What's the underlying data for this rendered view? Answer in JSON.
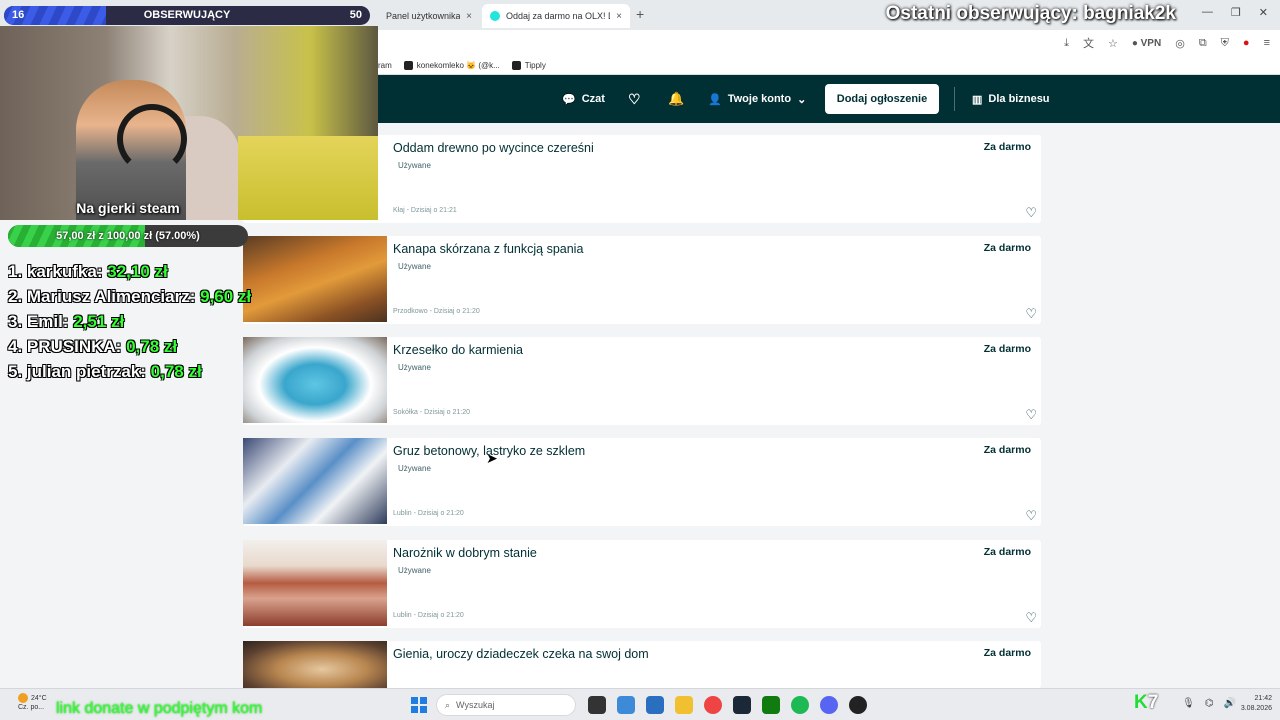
{
  "browser": {
    "tabs": [
      {
        "label": "Panel użytkownika",
        "close": "×"
      },
      {
        "label": "Oddaj za darmo na OLX! Dodaj",
        "close": "×"
      }
    ],
    "new_tab": "+",
    "window_controls": [
      "—",
      "❐",
      "✕"
    ],
    "vpn_label": "VPN",
    "bookmarks": [
      "ram",
      "konekomleko 🐱 (@k...",
      "Tipply"
    ]
  },
  "olx_header": {
    "chat_label": "Czat",
    "account_label": "Twoje konto",
    "add_listing_label": "Dodaj ogłoszenie",
    "business_label": "Dla biznesu"
  },
  "listings": [
    {
      "title": "Oddam drewno po wycince czereśni",
      "condition": "Używane",
      "location": "Kłaj - Dzisiaj o 21:21",
      "price": "Za darmo"
    },
    {
      "title": "Kanapa skórzana z funkcją spania",
      "condition": "Używane",
      "location": "Przodkowo - Dzisiaj o 21:20",
      "price": "Za darmo"
    },
    {
      "title": "Krzesełko do karmienia",
      "condition": "Używane",
      "location": "Sokółka - Dzisiaj o 21:20",
      "price": "Za darmo"
    },
    {
      "title": "Gruz betonowy, lastryko ze szklem",
      "condition": "Używane",
      "location": "Lublin - Dzisiaj o 21:20",
      "price": "Za darmo"
    },
    {
      "title": "Narożnik w dobrym stanie",
      "condition": "Używane",
      "location": "Lublin - Dzisiaj o 21:20",
      "price": "Za darmo"
    },
    {
      "title": "Gienia, uroczy dziadeczek czeka na swoj dom",
      "condition": "",
      "location": "",
      "price": "Za darmo"
    }
  ],
  "overlay": {
    "followers": {
      "min": "16",
      "label": "OBSERWUJĄCY",
      "max": "50",
      "current": 14,
      "goal": 50
    },
    "goal_title": "Na gierki steam",
    "goal_text": "57,00 zł z 100,00 zł (57.00%)",
    "goal_fraction": 0.57,
    "top_donors": [
      {
        "rank_name": "1. karkufka:",
        "amount": "32,10 zł"
      },
      {
        "rank_name": "2. Mariusz Alimenciarz:",
        "amount": "9,60 zł"
      },
      {
        "rank_name": "3. Emil:",
        "amount": "2,51 zł"
      },
      {
        "rank_name": "4. PRUSINKA:",
        "amount": "0,78 zł"
      },
      {
        "rank_name": "5. julian pietrzak:",
        "amount": "0,78 zł"
      }
    ],
    "last_follower": "Ostatni obserwujący: bagniak2k",
    "donate_link": "link donate w podpiętym kom",
    "k7_k": "K",
    "k7_n": "7"
  },
  "taskbar": {
    "weather_temp": "24°C",
    "weather_desc": "Cz. po...",
    "search_placeholder": "Wyszukaj",
    "time": "21:42",
    "date": "3.08.2026"
  },
  "colors": {
    "olx_header": "#002f34",
    "follow_fill": "#3c5ce8",
    "goal_fill": "#39d04a",
    "donor_amount": "#33ff33"
  }
}
